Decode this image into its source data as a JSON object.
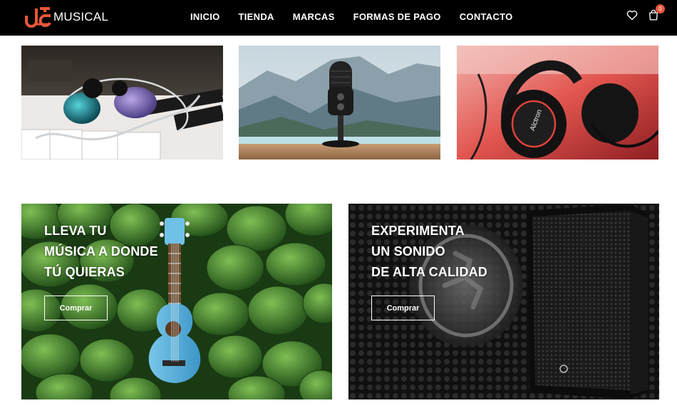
{
  "brand": {
    "logo_text": "MUSICAL",
    "accent_color": "#e8573a"
  },
  "nav": {
    "items": [
      {
        "label": "INICIO"
      },
      {
        "label": "TIENDA"
      },
      {
        "label": "MARCAS"
      },
      {
        "label": "FORMAS DE PAGO"
      },
      {
        "label": "CONTACTO"
      }
    ]
  },
  "header_icons": {
    "wishlist_icon": "heart-icon",
    "cart_icon": "shopping-bag-icon",
    "cart_count": "0"
  },
  "thumbnails": [
    {
      "subject": "in-ear-monitors-icon"
    },
    {
      "subject": "microphone-icon"
    },
    {
      "subject": "headphones-icon",
      "brand_text": "Alctron"
    }
  ],
  "banners": [
    {
      "title_lines": [
        "LLEVA TU",
        "MÚSICA A DONDE",
        "TÚ QUIERAS"
      ],
      "button_label": "Comprar",
      "image": "ukulele-on-leaves"
    },
    {
      "title_lines": [
        "EXPERIMENTA",
        "UN SONIDO",
        "DE ALTA CALIDAD"
      ],
      "button_label": "Comprar",
      "image": "loudspeaker"
    }
  ]
}
